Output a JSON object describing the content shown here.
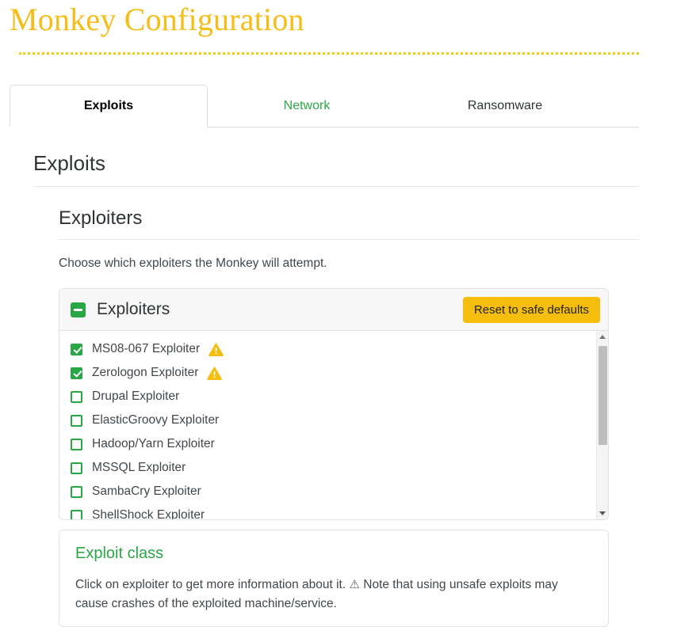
{
  "header": {
    "title": "Monkey Configuration"
  },
  "tabs": [
    {
      "label": "Exploits",
      "state": "active"
    },
    {
      "label": "Network",
      "state": "link"
    },
    {
      "label": "Ransomware",
      "state": "normal"
    }
  ],
  "section": {
    "heading": "Exploits",
    "subheading": "Exploiters",
    "description": "Choose which exploiters the Monkey will attempt."
  },
  "exploiters_panel": {
    "collapse_icon": "minus-square-icon",
    "title": "Exploiters",
    "reset_button": "Reset to safe defaults",
    "items": [
      {
        "label": "MS08-067 Exploiter",
        "checked": true,
        "warning": true
      },
      {
        "label": "Zerologon Exploiter",
        "checked": true,
        "warning": true
      },
      {
        "label": "Drupal Exploiter",
        "checked": false,
        "warning": false
      },
      {
        "label": "ElasticGroovy Exploiter",
        "checked": false,
        "warning": false
      },
      {
        "label": "Hadoop/Yarn Exploiter",
        "checked": false,
        "warning": false
      },
      {
        "label": "MSSQL Exploiter",
        "checked": false,
        "warning": false
      },
      {
        "label": "SambaCry Exploiter",
        "checked": false,
        "warning": false
      },
      {
        "label": "ShellShock Exploiter",
        "checked": false,
        "warning": false
      }
    ],
    "scrollbar": {
      "up_icon": "chevron-up-icon",
      "down_icon": "chevron-down-icon"
    }
  },
  "exploit_class": {
    "heading": "Exploit class",
    "text_before": "Click on exploiter to get more information about it.",
    "warning_glyph": "⚠",
    "text_after": "Note that using unsafe exploits may cause crashes of the exploited machine/service."
  },
  "colors": {
    "brand_amber": "#f5bd17",
    "accent_green": "#2aa745",
    "button_amber": "#f5bd0d",
    "warning_amber": "#f5bd0d"
  }
}
